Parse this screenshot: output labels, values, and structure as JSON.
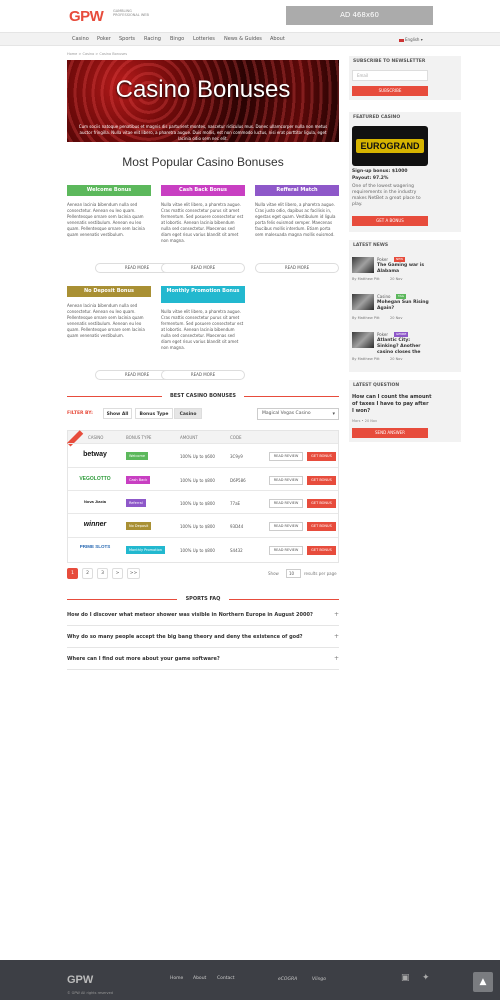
{
  "header": {
    "logo": "GPW",
    "logo_sub": "Gambling Professional Web",
    "ad": "AD 468x60"
  },
  "nav": {
    "items": [
      "Casino",
      "Poker",
      "Sports",
      "Racing",
      "Bingo",
      "Lotteries",
      "News & Guides",
      "About"
    ],
    "language": "English"
  },
  "breadcrumb": "Home > Casino > Casino Bonuses",
  "hero": {
    "title": "Casino Bonuses",
    "text": "Cum sociis natoque penatibus et magnis dis parturient montes, nascetur ridiculus mus. Donec ullamcorper nulla non metus auctor fringilla. Nulla vitae elit libero, a pharetra augue. Duis mollis, est non commodo luctus, nisi erat porttitor ligula, eget lacinia odio sem nec elit."
  },
  "popular": {
    "title": "Most Popular Casino Bonuses",
    "read_more": "READ MORE",
    "cards": [
      {
        "label": "Welcome Bonus",
        "color": "#5cb85c",
        "text": "Aenean lacinia bibendum nulla sed consectetur. Aenean eu leo quam. Pellentesque ornare sem lacinia quam venenatis vestibulum. Aenean eu leo quam. Pellentesque ornare sem lacinia quam venenatis vestibulum."
      },
      {
        "label": "Cash Back Bonus",
        "color": "#c83fc2",
        "text": "Nulla vitae elit libero, a pharetra augue. Cras mattis consectetur purus sit amet fermentum. Sed posuere consectetur est at lobortis. Aenean lacinia bibendum nulla sed consectetur. Maecenas sed diam eget risus varius blandit sit amet non magna."
      },
      {
        "label": "Refferal Match",
        "color": "#8e58c9",
        "text": "Nulla vitae elit libero, a pharetra augue. Cras justo odio, dapibus ac facilisis in, egestas eget quam. Vestibulum id ligula porta felis euismod semper. Maecenas faucibus mollis interdum. Etiam porta sem malesuada magna mollis euismod."
      },
      {
        "label": "No Deposit Bonus",
        "color": "#a99034",
        "text": "Aenean lacinia bibendum nulla sed consectetur. Aenean eu leo quam. Pellentesque ornare sem lacinia quam venenatis vestibulum. Aenean eu leo quam. Pellentesque ornare sem lacinia quam venenatis vestibulum."
      },
      {
        "label": "Monthly Promotion Bonus",
        "color": "#22b8cf",
        "text": "Nulla vitae elit libero, a pharetra augue. Cras mattis consectetur purus sit amet fermentum. Sed posuere consectetur est at lobortis. Aenean lacinia bibendum nulla sed consectetur. Maecenas sed diam eget risus varius blandit sit amet non magna."
      }
    ]
  },
  "best": {
    "title": "BEST CASINO BONUSES",
    "filter_label": "FILTER BY:",
    "filters": [
      "Show All",
      "Bonus Type",
      "Casino"
    ],
    "select": "Magical Vegas Casino",
    "columns": [
      "CASINO",
      "BONUS TYPE",
      "AMOUNT",
      "CODE"
    ],
    "review": "READ REVIEW",
    "get": "GET BONUS",
    "rows": [
      {
        "casino": "betway",
        "casino_color": "#111",
        "type": "Welcome",
        "type_color": "#5cb85c",
        "amount": "100% Up to $600",
        "code": "3C9y9"
      },
      {
        "casino": "VEGOLOTTO",
        "casino_color": "#2e9b3a",
        "type": "Cash Back",
        "type_color": "#c83fc2",
        "amount": "100% Up to $800",
        "code": "D6P586"
      },
      {
        "casino": "Nova Jiaxia",
        "casino_color": "#222",
        "type": "Referral",
        "type_color": "#8e58c9",
        "amount": "100% Up to $800",
        "code": "77aE"
      },
      {
        "casino": "winner",
        "casino_color": "#111",
        "type": "No Deposit",
        "type_color": "#a99034",
        "amount": "100% Up to $800",
        "code": "93D44"
      },
      {
        "casino": "PRIME SLOTS",
        "casino_color": "#2a6ab3",
        "type": "Monthly Promotion",
        "type_color": "#22b8cf",
        "amount": "100% Up to $800",
        "code": "S4432"
      }
    ]
  },
  "pagination": {
    "pages": [
      "1",
      "2",
      "3",
      ">",
      ">>"
    ],
    "show": "Show",
    "per": "10",
    "results": "results per page"
  },
  "faq": {
    "title": "SPORTS FAQ",
    "items": [
      "How do I discover what meteor shower was visible in Northern Europe in August 2000?",
      "Why do so many people accept the big bang theory and deny the existence of god?",
      "Where can I find out more about your game software?"
    ]
  },
  "sidebar": {
    "newsletter": {
      "title": "SUBSCRIBE TO NEWSLETTER",
      "placeholder": "Email",
      "button": "SUBSCRIBE"
    },
    "featured": {
      "title": "FEATURED CASINO",
      "logo": "EUROGRAND",
      "signup": "Sign-up bonus: $1000",
      "payout": "Payout: 97.2%",
      "text": "One of the lowest wagering requirements in the industry makes NetBet a great place to play.",
      "button": "GET A BONUS"
    },
    "news": {
      "title": "LATEST NEWS",
      "items": [
        {
          "cat": "Poker",
          "tag": "NEW",
          "tag_color": "#e74c3c",
          "title": "The Gaming war is Alabama",
          "by": "By Matthew Pitt",
          "date": "20 Nov"
        },
        {
          "cat": "Casino",
          "tag": "TAG",
          "tag_color": "#5cb85c",
          "title": "Mohegan Sun Rising Again?",
          "by": "By Matthew Pitt",
          "date": "20 Nov"
        },
        {
          "cat": "Poker",
          "tag": "GENRE",
          "tag_color": "#8e58c9",
          "title": "Atlantic City: Sinking? Another casino closes the",
          "by": "By Matthew Pitt",
          "date": "20 Nov"
        }
      ]
    },
    "question": {
      "title": "LATEST QUESTION",
      "text": "How can I count the amount of taxes I have to pay after I won?",
      "meta": "Mars • 20 Nov",
      "button": "SEND ANSWER"
    }
  },
  "footer": {
    "logo": "GPW",
    "links": [
      "Home",
      "About",
      "Contact"
    ],
    "copyright": "© GPW All rights reserved",
    "badges": [
      "eCOGRA",
      "Vlingo"
    ]
  }
}
